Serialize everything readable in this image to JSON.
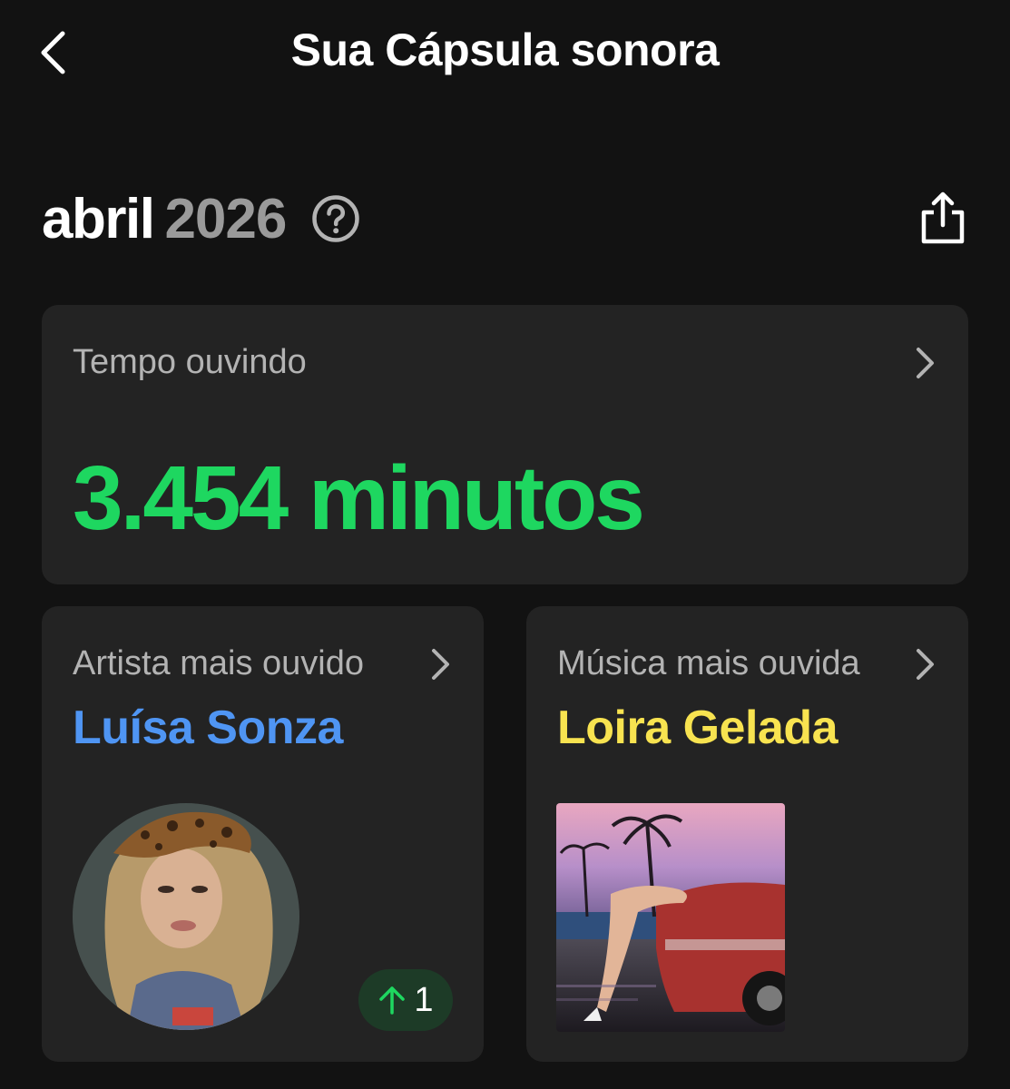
{
  "header": {
    "title": "Sua Cápsula sonora",
    "back_icon": "chevron-left-icon"
  },
  "period": {
    "month": "abril",
    "year": "2026",
    "help_icon": "question-circle-icon",
    "share_icon": "share-icon"
  },
  "listening_time": {
    "label": "Tempo ouvindo",
    "value": "3.454 minutos",
    "chevron_icon": "chevron-right-icon"
  },
  "top_artist": {
    "label": "Artista mais ouvido",
    "name": "Luísa Sonza",
    "rank_change": "1",
    "rank_icon": "arrow-up-icon"
  },
  "top_track": {
    "label": "Música mais ouvida",
    "name": "Loira Gelada"
  },
  "colors": {
    "background": "#121212",
    "card": "#232323",
    "accent_green": "#1ed760",
    "artist_blue": "#4f95f3",
    "track_yellow": "#f8e350",
    "muted_text": "#b3b3b3",
    "year_gray": "#9a9a9a",
    "badge_bg": "#1d3b27"
  }
}
